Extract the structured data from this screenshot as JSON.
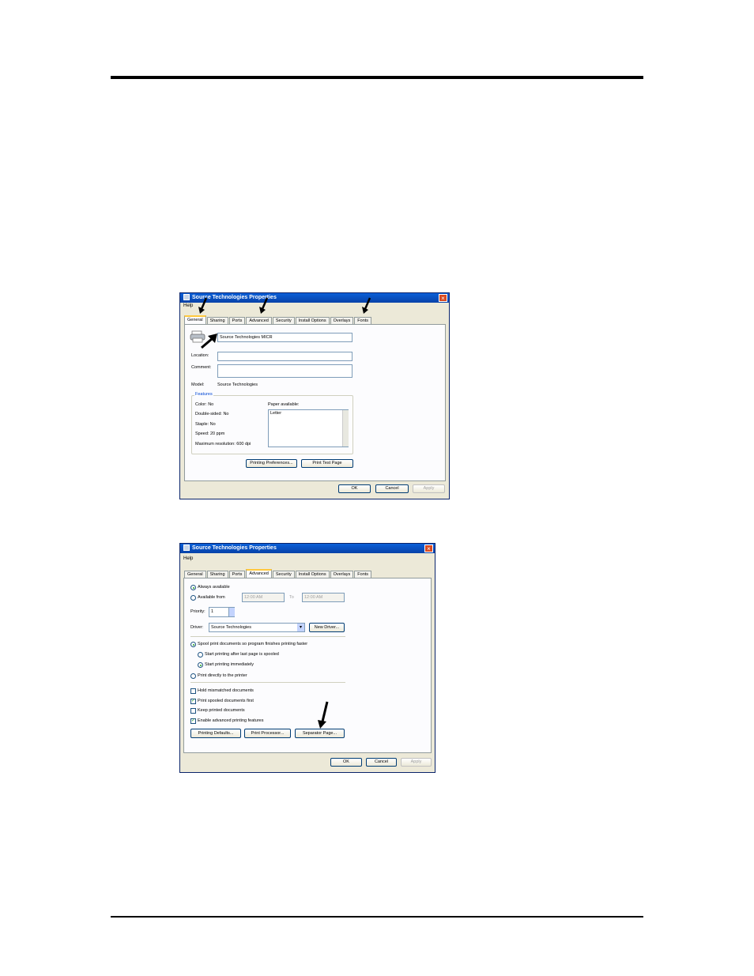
{
  "dialog1": {
    "title": "Source Technologies Properties",
    "menu": "Help",
    "tabs": [
      "General",
      "Sharing",
      "Ports",
      "Advanced",
      "Security",
      "Install Options",
      "Overlays",
      "Fonts"
    ],
    "active_tab": "General",
    "printer_name": "Source Technologies MICR",
    "location_label": "Location:",
    "location_value": "",
    "comment_label": "Comment:",
    "comment_value": "",
    "model_label": "Model:",
    "model_value": "Source Technologies",
    "features_label": "Features",
    "color": "Color: No",
    "double_sided": "Double-sided: No",
    "staple": "Staple: No",
    "speed": "Speed: 20 ppm",
    "max_resolution": "Maximum resolution: 600 dpi",
    "paper_available_label": "Paper available:",
    "paper_item": "Letter",
    "printing_prefs_button": "Printing Preferences...",
    "print_test_button": "Print Test Page",
    "ok_button": "OK",
    "cancel_button": "Cancel",
    "apply_button": "Apply"
  },
  "dialog2": {
    "title": "Source Technologies Properties",
    "menu": "Help",
    "tabs": [
      "General",
      "Sharing",
      "Ports",
      "Advanced",
      "Security",
      "Install Options",
      "Overlays",
      "Fonts"
    ],
    "active_tab": "Advanced",
    "always_available": "Always available",
    "available_from": "Available from",
    "from_time": "12:00 AM",
    "to_label": "To",
    "to_time": "12:00 AM",
    "priority_label": "Priority:",
    "priority_value": "1",
    "driver_label": "Driver:",
    "driver_value": "Source Technologies",
    "new_driver_button": "New Driver...",
    "spool": "Spool print documents so program finishes printing faster",
    "start_after_last": "Start printing after last page is spooled",
    "start_immediately": "Start printing immediately",
    "print_directly": "Print directly to the printer",
    "hold_mismatched": "Hold mismatched documents",
    "print_spooled_first": "Print spooled documents first",
    "keep_printed": "Keep printed documents",
    "enable_advanced": "Enable advanced printing features",
    "printing_defaults_button": "Printing Defaults...",
    "print_processor_button": "Print Processor...",
    "separator_page_button": "Separator Page...",
    "ok_button": "OK",
    "cancel_button": "Cancel",
    "apply_button": "Apply"
  },
  "icons": [
    "printer-icon",
    "arrow-icon"
  ],
  "colors": {
    "titlebar": "#0a5fd8",
    "window_bg": "#ece9d8",
    "group_label": "#0046d5"
  }
}
